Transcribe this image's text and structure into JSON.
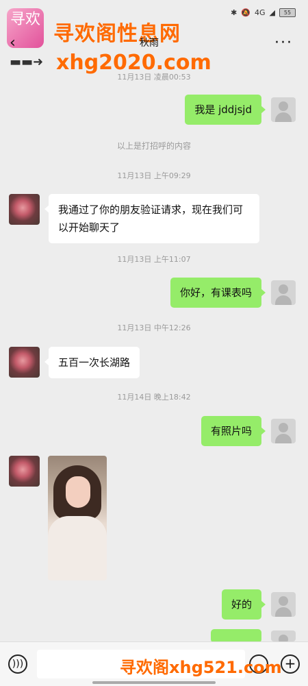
{
  "status": {
    "battery": "55",
    "signal": "4G"
  },
  "watermark": {
    "logo": "寻欢",
    "top": "寻欢阁性息网",
    "mid": "xhg2020.com",
    "bottom": "寻欢阁xhg521.com"
  },
  "header": {
    "back": "‹",
    "name": "秋雨",
    "more": "···"
  },
  "messages": {
    "ts1": "11月13日 凌晨00:53",
    "m1": "我是 jddjsjd",
    "sys1": "以上是打招呼的内容",
    "ts2": "11月13日 上午09:29",
    "m2": "我通过了你的朋友验证请求，现在我们可以开始聊天了",
    "ts3": "11月13日 上午11:07",
    "m3": "你好，有课表吗",
    "ts4": "11月13日 中午12:26",
    "m4": "五百一次长湖路",
    "ts5": "11月14日 晚上18:42",
    "m5": "有照片吗",
    "m6": "好的"
  },
  "colors": {
    "bubble_me": "#95ec69",
    "bubble_other": "#ffffff",
    "background": "#ededed"
  }
}
